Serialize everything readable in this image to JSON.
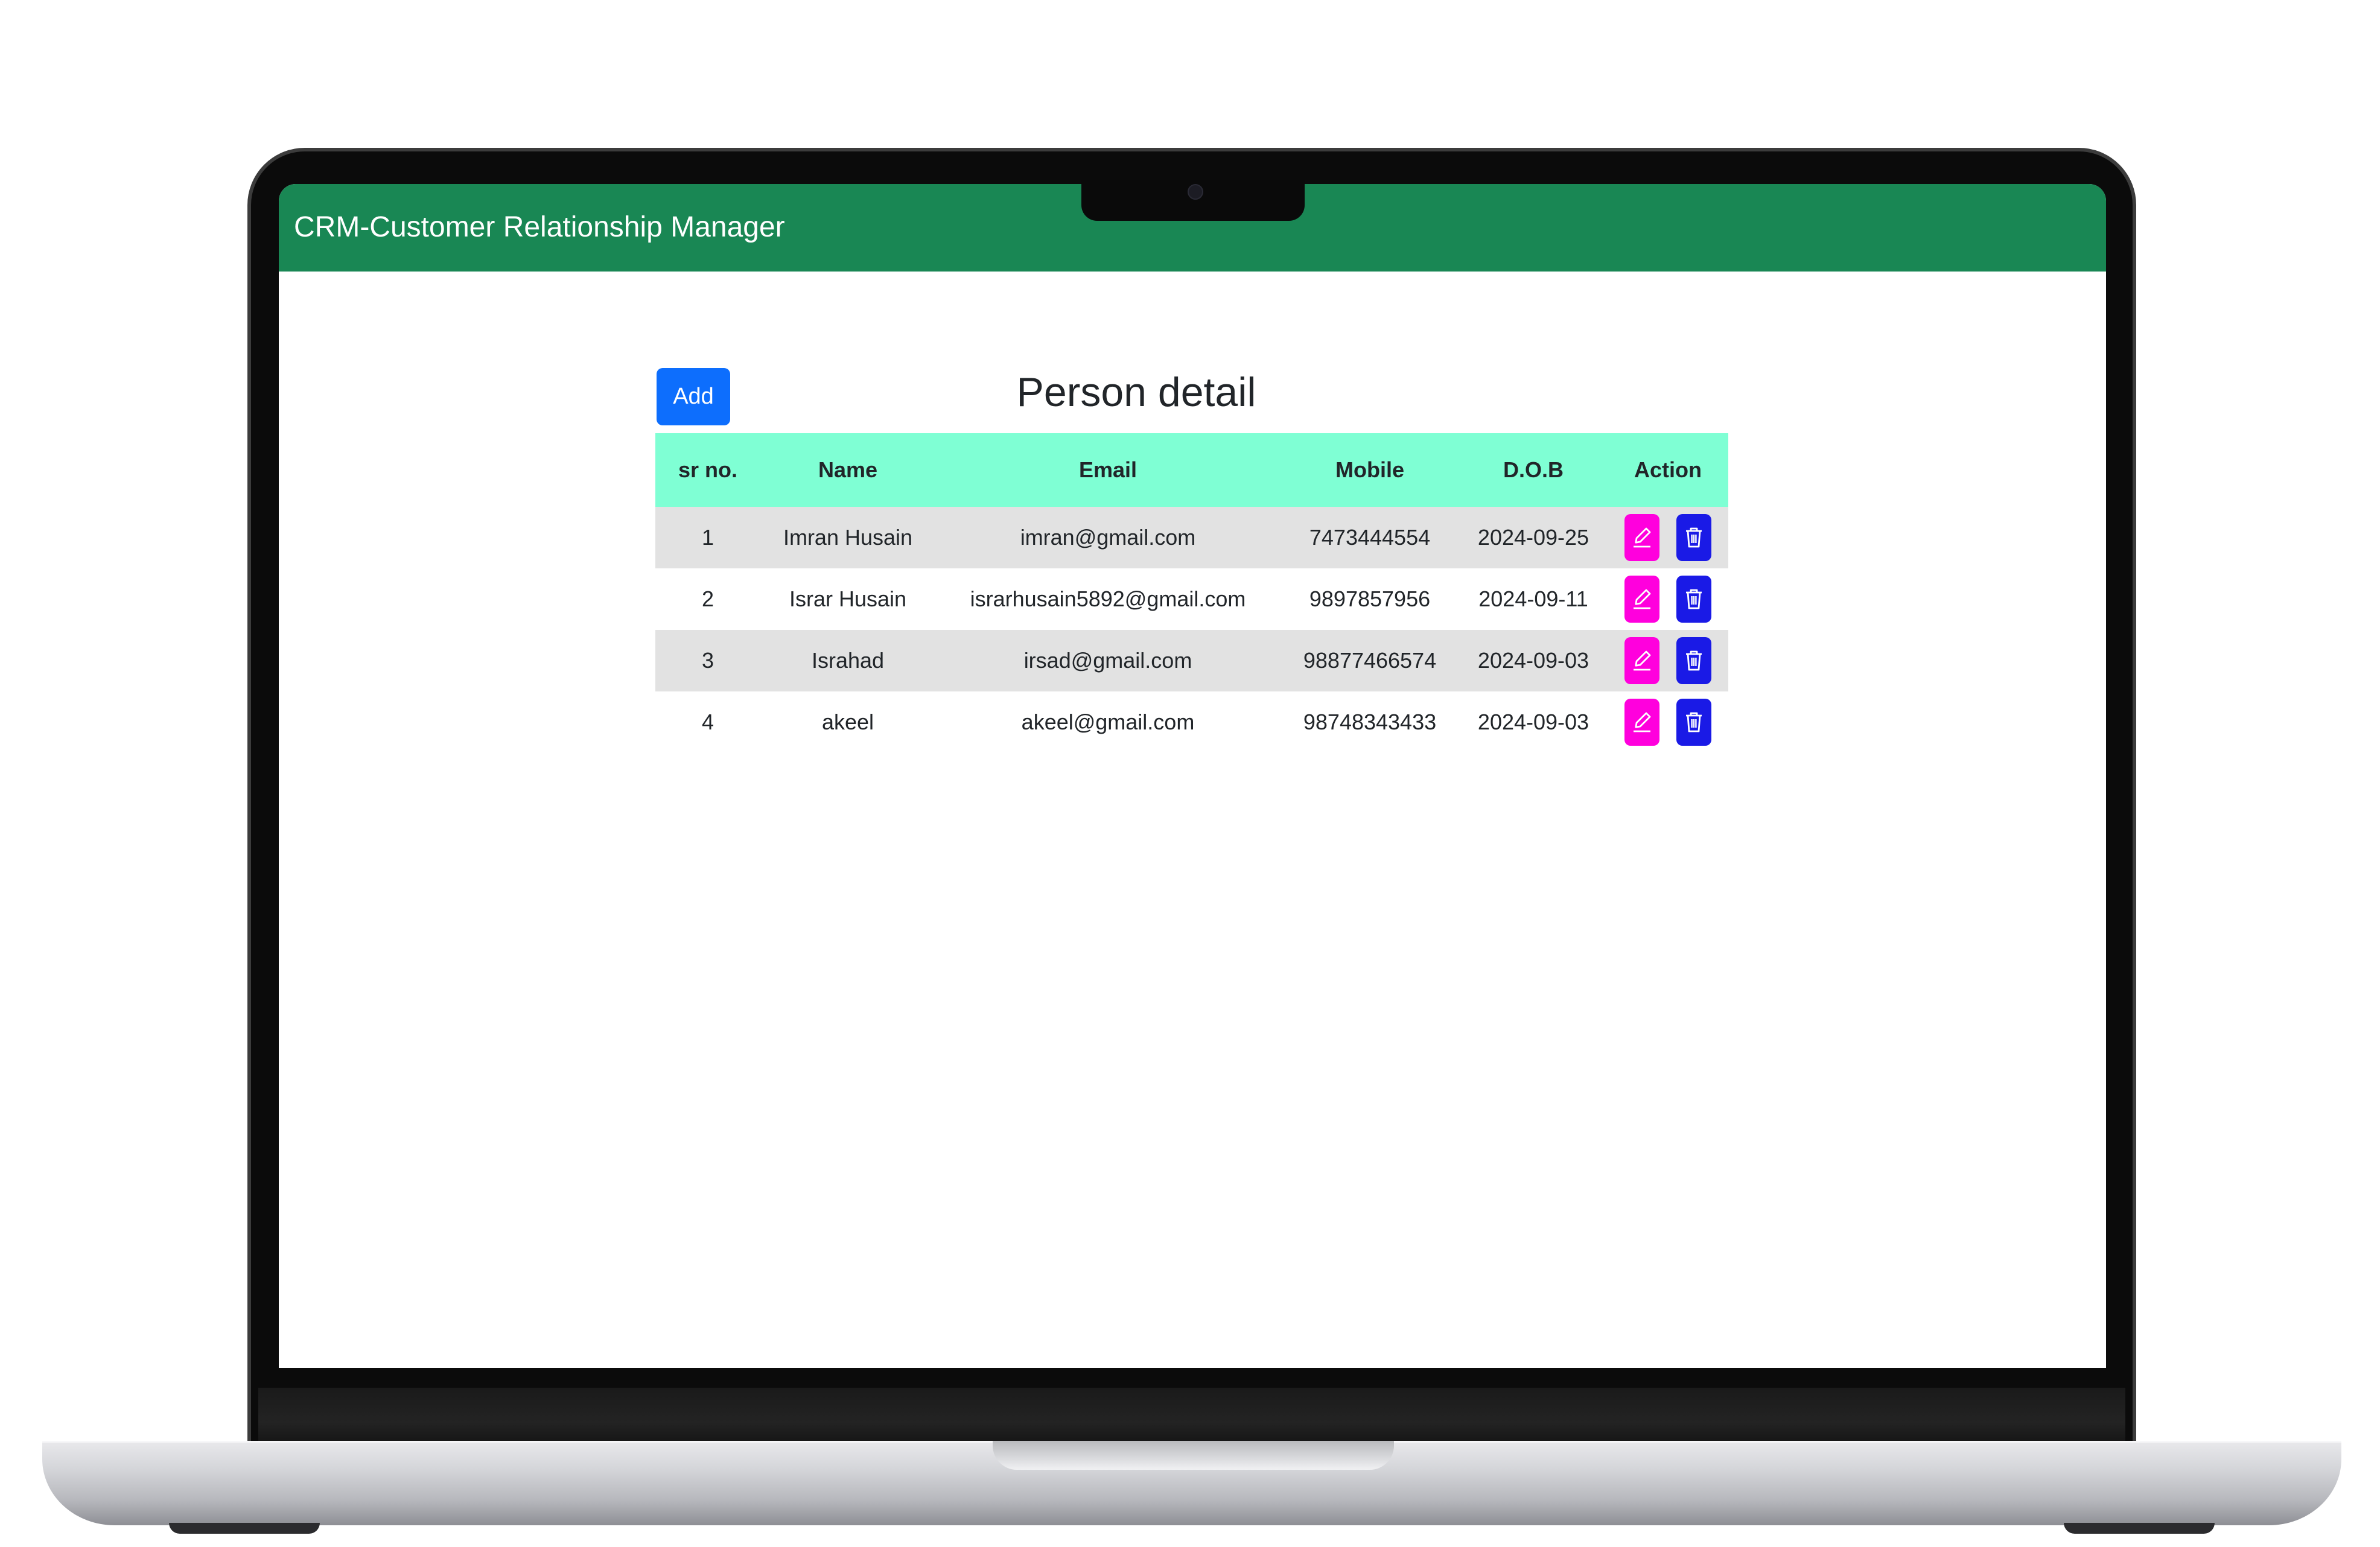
{
  "app": {
    "brand": "CRM-Customer Relationship Manager"
  },
  "toolbar": {
    "add_label": "Add"
  },
  "page": {
    "title": "Person detail"
  },
  "table": {
    "columns": [
      "sr no.",
      "Name",
      "Email",
      "Mobile",
      "D.O.B",
      "Action"
    ],
    "rows": [
      {
        "sr": "1",
        "name": "Imran Husain",
        "email": "imran@gmail.com",
        "mobile": "7473444554",
        "dob": "2024-09-25"
      },
      {
        "sr": "2",
        "name": "Israr Husain",
        "email": "israrhusain5892@gmail.com",
        "mobile": "9897857956",
        "dob": "2024-09-11"
      },
      {
        "sr": "3",
        "name": "Israhad",
        "email": "irsad@gmail.com",
        "mobile": "98877466574",
        "dob": "2024-09-03"
      },
      {
        "sr": "4",
        "name": "akeel",
        "email": "akeel@gmail.com",
        "mobile": "98748343433",
        "dob": "2024-09-03"
      }
    ],
    "action_icons": {
      "edit": "pencil-square-icon",
      "delete": "trash-icon"
    }
  },
  "colors": {
    "navbar": "#198754",
    "header_row": "#7fffd4",
    "add_button": "#0d6efd",
    "edit_button": "#ff00dd",
    "delete_button": "#1a1ae6"
  }
}
